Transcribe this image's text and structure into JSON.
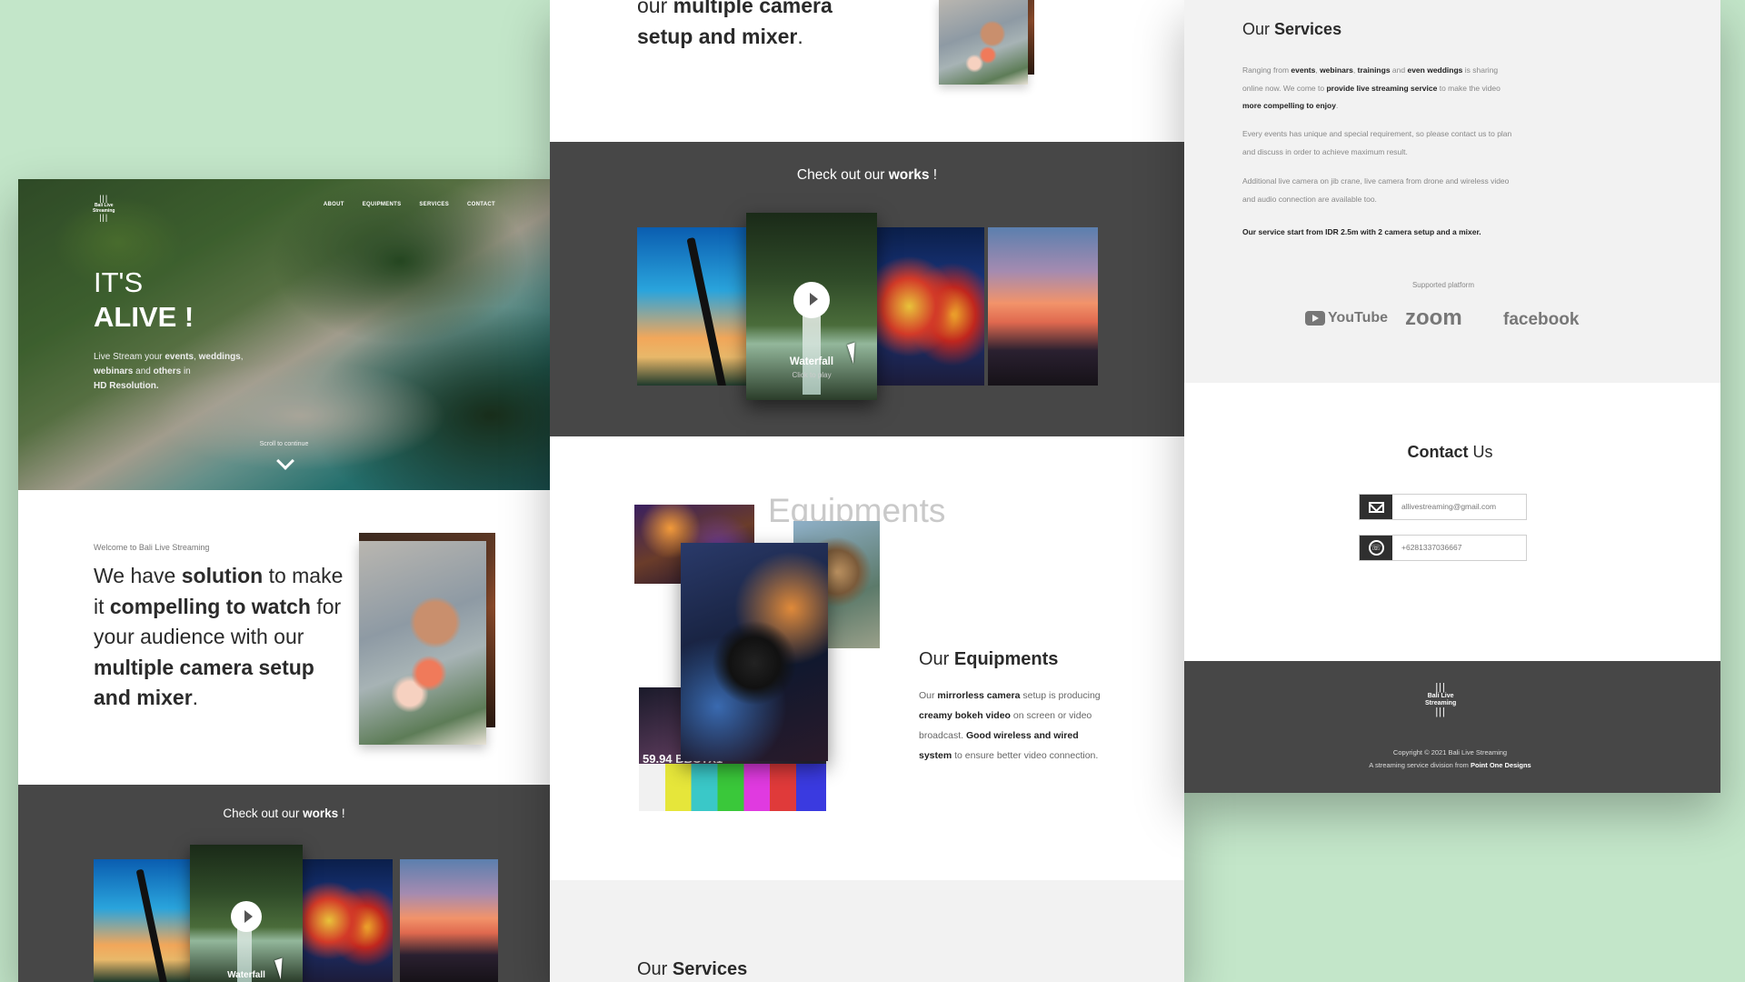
{
  "brand": {
    "name_line1": "Bali Live",
    "name_line2": "Streaming",
    "bars": "|||"
  },
  "nav": [
    "ABOUT",
    "EQUIPMENTS",
    "SERVICES",
    "CONTACT"
  ],
  "hero": {
    "title_line1": "IT'S",
    "title_line2": "ALIVE !",
    "sub_parts": [
      "Live Stream your ",
      "events",
      ", ",
      "weddings",
      ", ",
      "webinars",
      " and ",
      "others",
      " in ",
      "HD Resolution."
    ],
    "scroll_hint": "Scroll to continue"
  },
  "intro": {
    "welcome": "Welcome to Bali Live Streaming",
    "statement_parts": [
      "We have ",
      "solution",
      " to make it ",
      "compelling to watch",
      " for your audience with our ",
      "multiple camera setup and mixer",
      "."
    ],
    "statement_tail_line1": "our ",
    "statement_tail_bold1": "multiple camera",
    "statement_tail_bold2": "setup and mixer",
    "statement_tail_end": "."
  },
  "works": {
    "title_pre": "Check out our ",
    "title_bold": "works",
    "title_post": " !",
    "featured_title": "Waterfall",
    "featured_sub": "Click to play",
    "icons": {
      "play": "play-icon"
    }
  },
  "equipments": {
    "watermark": "Equipments",
    "heading_pre": "Our ",
    "heading_bold": "Equipments",
    "body_parts": [
      "Our ",
      "mirrorless camera",
      " setup is producing ",
      "creamy bokeh video",
      " on screen or video broadcast. ",
      "Good wireless and wired system",
      " to ensure better video connection."
    ],
    "broadcast_text": "59.94 BBCTX1"
  },
  "services": {
    "heading_pre": "Our ",
    "heading_bold": "Services",
    "p1_parts": [
      "Ranging from ",
      "events",
      ", ",
      "webinars",
      ", ",
      "trainings",
      " and ",
      "even weddings",
      " is sharing online now. We come to ",
      "provide live streaming service",
      " to make the video ",
      "more compelling to enjoy",
      "."
    ],
    "p2": "Every events has unique and special requirement, so please contact us to plan and discuss in order to achieve maximum result.",
    "p3": "Additional live camera on jib crane, live camera from drone and wireless video and audio connection are available too.",
    "p4": "Our service start from IDR 2.5m with 2 camera setup and a mixer.",
    "platform_caption": "Supported platform",
    "platforms": [
      "YouTube",
      "zoom",
      "facebook"
    ]
  },
  "contact": {
    "heading_bold": "Contact",
    "heading_post": " Us",
    "email": "allivestreaming@gmail.com",
    "phone": "+6281337036667"
  },
  "footer": {
    "copyright": "Copyright © 2021 Bali Live Streaming",
    "division_pre": "A streaming service division from ",
    "division_bold": "Point One Designs"
  },
  "colors": {
    "background": "#c3e6c9",
    "dark_band": "#474747",
    "light_band": "#f2f2f2",
    "text": "#2a2a2a"
  }
}
